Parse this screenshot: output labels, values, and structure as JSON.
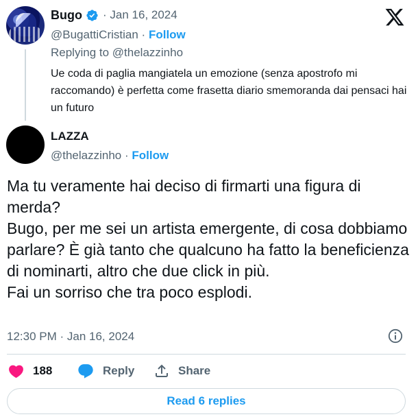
{
  "parent_tweet": {
    "author_name": "Bugo",
    "separator": "·",
    "date": "Jan 16, 2024",
    "handle": "@BugattiCristian",
    "follow_label": "Follow",
    "replying_to": "Replying to @thelazzinho",
    "text": "Ue coda di paglia mangiatela un emozione (senza apostrofo mi raccomando) è perfetta come frasetta diario smemoranda dai pensaci hai un futuro",
    "verified": true
  },
  "main_tweet": {
    "author_name": "LAZZA",
    "handle": "@thelazzinho",
    "follow_label": "Follow",
    "text_lines": [
      "Ma tu veramente hai deciso di firmarti una figura di merda?",
      "Bugo, per me sei un artista emergente, di cosa dobbiamo parlare? È già tanto che qualcuno ha fatto la beneficienza di nominarti, altro che due click in più.",
      "Fai un sorriso che tra poco esplodi."
    ],
    "timestamp": "12:30 PM · Jan 16, 2024"
  },
  "actions": {
    "like_count": "188",
    "reply_label": "Reply",
    "share_label": "Share"
  },
  "read_replies_label": "Read 6 replies",
  "colors": {
    "accent": "#1d9bf0",
    "like": "#f91880",
    "text": "#0f1419",
    "muted": "#536471",
    "border": "#cfd9de"
  },
  "icons": [
    "verified-badge-icon",
    "x-logo-icon",
    "info-icon",
    "heart-icon",
    "reply-bubble-icon",
    "share-icon"
  ]
}
